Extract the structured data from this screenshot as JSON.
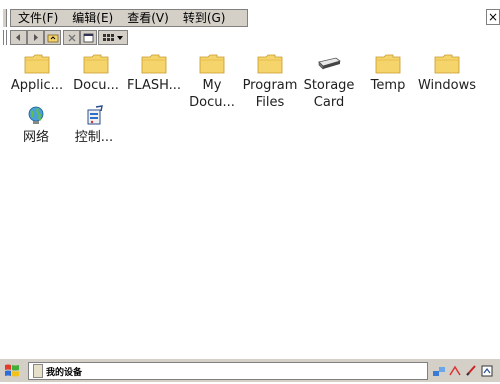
{
  "menubar": {
    "items": [
      "文件(F)",
      "编辑(E)",
      "查看(V)",
      "转到(G)"
    ],
    "close_label": "×"
  },
  "toolbar": {
    "buttons": [
      "back-icon",
      "forward-icon",
      "up-folder-icon",
      "delete-icon",
      "properties-icon",
      "view-menu-icon"
    ]
  },
  "items": [
    {
      "label": "Applic...",
      "icon": "folder-icon"
    },
    {
      "label": "Docu...",
      "icon": "folder-icon"
    },
    {
      "label": "FLASH...",
      "icon": "folder-icon"
    },
    {
      "label": "My\nDocu...",
      "line1": "My",
      "line2": "Docu...",
      "icon": "folder-icon"
    },
    {
      "label": "Program Files",
      "line1": "Program",
      "line2": "Files",
      "icon": "folder-icon"
    },
    {
      "label": "Storage Card",
      "line1": "Storage",
      "line2": "Card",
      "icon": "storage-card-icon"
    },
    {
      "label": "Temp",
      "icon": "folder-icon"
    },
    {
      "label": "Windows",
      "icon": "folder-icon"
    },
    {
      "label": "网络",
      "icon": "network-icon"
    },
    {
      "label": "控制...",
      "icon": "control-panel-icon"
    }
  ],
  "taskbar": {
    "task_label": "我的设备",
    "start_icon": "windows-start-icon",
    "tray_icons": [
      "network-tray-icon",
      "keyboard-tray-icon",
      "volume-tray-icon",
      "input-panel-icon"
    ]
  },
  "colors": {
    "folder": "#f5d46b",
    "folder_dark": "#d9a92f",
    "chrome": "#d4d0c8"
  }
}
